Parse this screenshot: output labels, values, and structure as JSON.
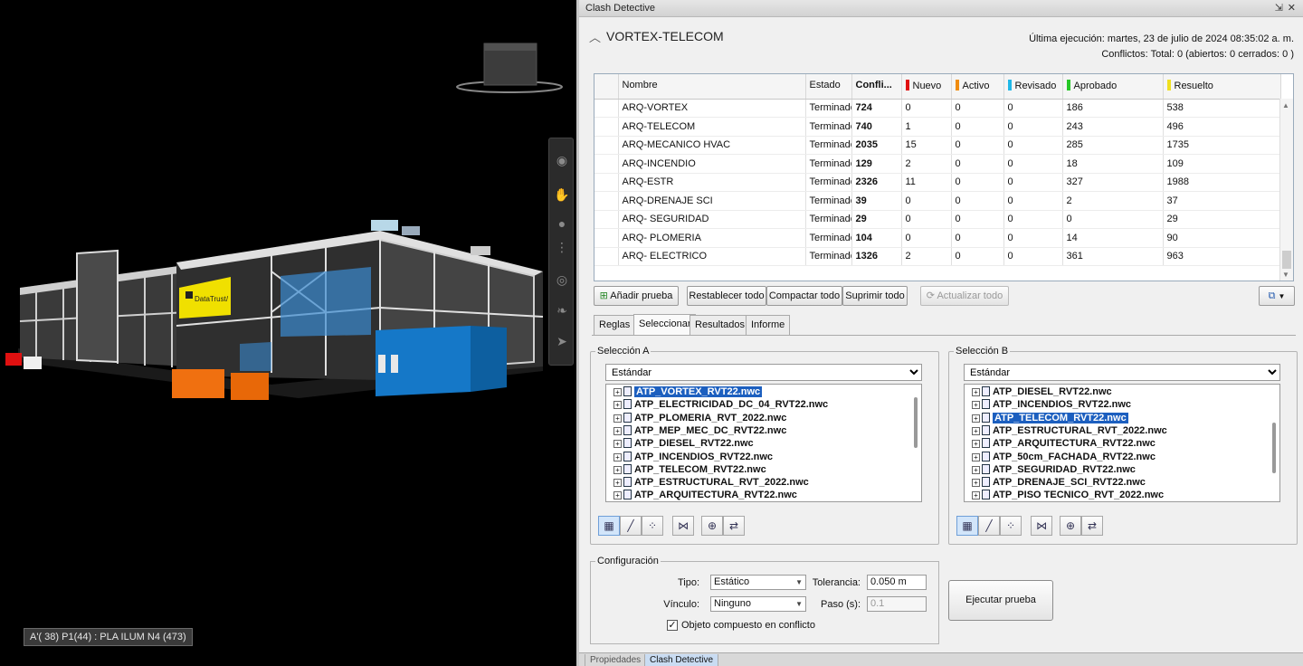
{
  "viewport": {
    "status_text": "A'( 38) P1(44) : PLA ILUM N4 (473)",
    "logo_text": "DataTrust/"
  },
  "panel": {
    "title": "Clash Detective",
    "test_name": "VORTEX-TELECOM",
    "last_run_label": "Última ejecución:",
    "last_run_value": "martes, 23 de julio de 2024 08:35:02 a. m.",
    "conflicts_label": "Conflictos:",
    "conflicts_total": "Total:",
    "conflicts_total_value": "0",
    "conflicts_open": "(abiertos:",
    "conflicts_open_value": "0",
    "conflicts_closed": "cerrados:",
    "conflicts_closed_value": "0 )"
  },
  "grid": {
    "columns": [
      {
        "label": "Nombre",
        "color": null
      },
      {
        "label": "Estado",
        "color": null
      },
      {
        "label": "Confli...",
        "color": null
      },
      {
        "label": "Nuevo",
        "color": "#e01010"
      },
      {
        "label": "Activo",
        "color": "#f08c10"
      },
      {
        "label": "Revisado",
        "color": "#20b8e8"
      },
      {
        "label": "Aprobado",
        "color": "#28c828"
      },
      {
        "label": "Resuelto",
        "color": "#f0e020"
      }
    ],
    "rows": [
      [
        "ARQ-VORTEX",
        "Terminado",
        "724",
        "0",
        "0",
        "0",
        "186",
        "538"
      ],
      [
        "ARQ-TELECOM",
        "Terminado",
        "740",
        "1",
        "0",
        "0",
        "243",
        "496"
      ],
      [
        "ARQ-MECANICO HVAC",
        "Terminado",
        "2035",
        "15",
        "0",
        "0",
        "285",
        "1735"
      ],
      [
        "ARQ-INCENDIO",
        "Terminado",
        "129",
        "2",
        "0",
        "0",
        "18",
        "109"
      ],
      [
        "ARQ-ESTR",
        "Terminado",
        "2326",
        "11",
        "0",
        "0",
        "327",
        "1988"
      ],
      [
        "ARQ-DRENAJE SCI",
        "Terminado",
        "39",
        "0",
        "0",
        "0",
        "2",
        "37"
      ],
      [
        "ARQ- SEGURIDAD",
        "Terminado",
        "29",
        "0",
        "0",
        "0",
        "0",
        "29"
      ],
      [
        "ARQ- PLOMERIA",
        "Terminado",
        "104",
        "0",
        "0",
        "0",
        "14",
        "90"
      ],
      [
        "ARQ- ELECTRICO",
        "Terminado",
        "1326",
        "2",
        "0",
        "0",
        "361",
        "963"
      ]
    ]
  },
  "actions": {
    "add_test": "Añadir prueba",
    "reset_all": "Restablecer todo",
    "compact_all": "Compactar todo",
    "delete_all": "Suprimir todo",
    "update_all": "Actualizar todo"
  },
  "tabs": [
    "Reglas",
    "Seleccionar",
    "Resultados",
    "Informe"
  ],
  "selection_a": {
    "legend": "Selección A",
    "mode": "Estándar",
    "items": [
      "ATP_VORTEX_RVT22.nwc",
      "ATP_ELECTRICIDAD_DC_04_RVT22.nwc",
      "ATP_PLOMERIA_RVT_2022.nwc",
      "ATP_MEP_MEC_DC_RVT22.nwc",
      "ATP_DIESEL_RVT22.nwc",
      "ATP_INCENDIOS_RVT22.nwc",
      "ATP_TELECOM_RVT22.nwc",
      "ATP_ESTRUCTURAL_RVT_2022.nwc",
      "ATP_ARQUITECTURA_RVT22.nwc"
    ],
    "selected_index": 0
  },
  "selection_b": {
    "legend": "Selección B",
    "mode": "Estándar",
    "items": [
      "ATP_DIESEL_RVT22.nwc",
      "ATP_INCENDIOS_RVT22.nwc",
      "ATP_TELECOM_RVT22.nwc",
      "ATP_ESTRUCTURAL_RVT_2022.nwc",
      "ATP_ARQUITECTURA_RVT22.nwc",
      "ATP_50cm_FACHADA_RVT22.nwc",
      "ATP_SEGURIDAD_RVT22.nwc",
      "ATP_DRENAJE_SCI_RVT22.nwc",
      "ATP_PISO TECNICO_RVT_2022.nwc"
    ],
    "selected_index": 2
  },
  "config": {
    "legend": "Configuración",
    "type_label": "Tipo:",
    "type_value": "Estático",
    "tolerance_label": "Tolerancia:",
    "tolerance_value": "0.050 m",
    "link_label": "Vínculo:",
    "link_value": "Ninguno",
    "step_label": "Paso (s):",
    "step_value": "0.1",
    "composite_label": "Objeto compuesto en conflicto",
    "composite_checked": true
  },
  "run_button": "Ejecutar prueba",
  "bottom_tabs": [
    "Propiedades",
    "Clash Detective"
  ]
}
